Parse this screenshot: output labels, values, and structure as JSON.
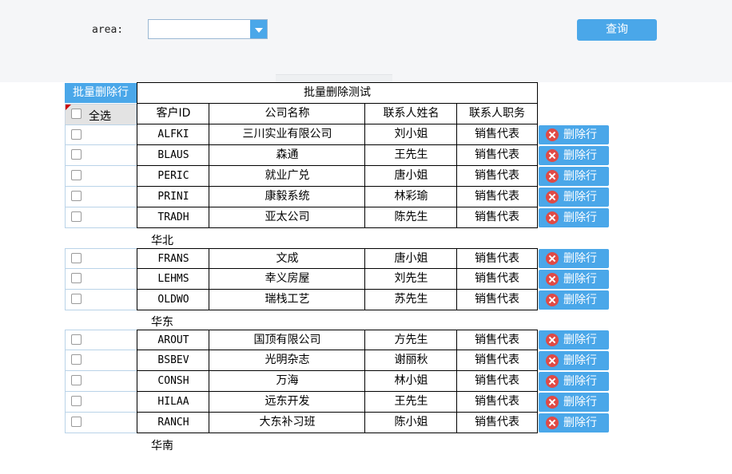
{
  "toolbar": {
    "area_label": "area:",
    "area_value": "",
    "query_label": "查询"
  },
  "grid": {
    "batch_delete_label": "批量删除行",
    "title": "批量删除测试",
    "select_all_label": "全选",
    "columns": [
      "客户ID",
      "公司名称",
      "联系人姓名",
      "联系人职务"
    ],
    "delete_label": "删除行",
    "groups": [
      {
        "label": "华北",
        "rows": [
          [
            "ALFKI",
            "三川实业有限公司",
            "刘小姐",
            "销售代表"
          ],
          [
            "BLAUS",
            "森通",
            "王先生",
            "销售代表"
          ],
          [
            "PERIC",
            "就业广兑",
            "唐小姐",
            "销售代表"
          ],
          [
            "PRINI",
            "康毅系统",
            "林彩瑜",
            "销售代表"
          ],
          [
            "TRADH",
            "亚太公司",
            "陈先生",
            "销售代表"
          ]
        ]
      },
      {
        "label": "华东",
        "rows": [
          [
            "FRANS",
            "文成",
            "唐小姐",
            "销售代表"
          ],
          [
            "LEHMS",
            "幸义房屋",
            "刘先生",
            "销售代表"
          ],
          [
            "OLDWO",
            "瑞栈工艺",
            "苏先生",
            "销售代表"
          ]
        ]
      },
      {
        "label": "华南",
        "rows": [
          [
            "AROUT",
            "国顶有限公司",
            "方先生",
            "销售代表"
          ],
          [
            "BSBEV",
            "光明杂志",
            "谢丽秋",
            "销售代表"
          ],
          [
            "CONSH",
            "万海",
            "林小姐",
            "销售代表"
          ],
          [
            "HILAA",
            "远东开发",
            "王先生",
            "销售代表"
          ],
          [
            "RANCH",
            "大东补习班",
            "陈小姐",
            "销售代表"
          ]
        ]
      }
    ]
  },
  "colors": {
    "accent": "#4aa7e9",
    "delete_icon": "#e04a45",
    "select_all_bg": "#e3e3e3",
    "topbar_bg": "#f5f6f8"
  }
}
